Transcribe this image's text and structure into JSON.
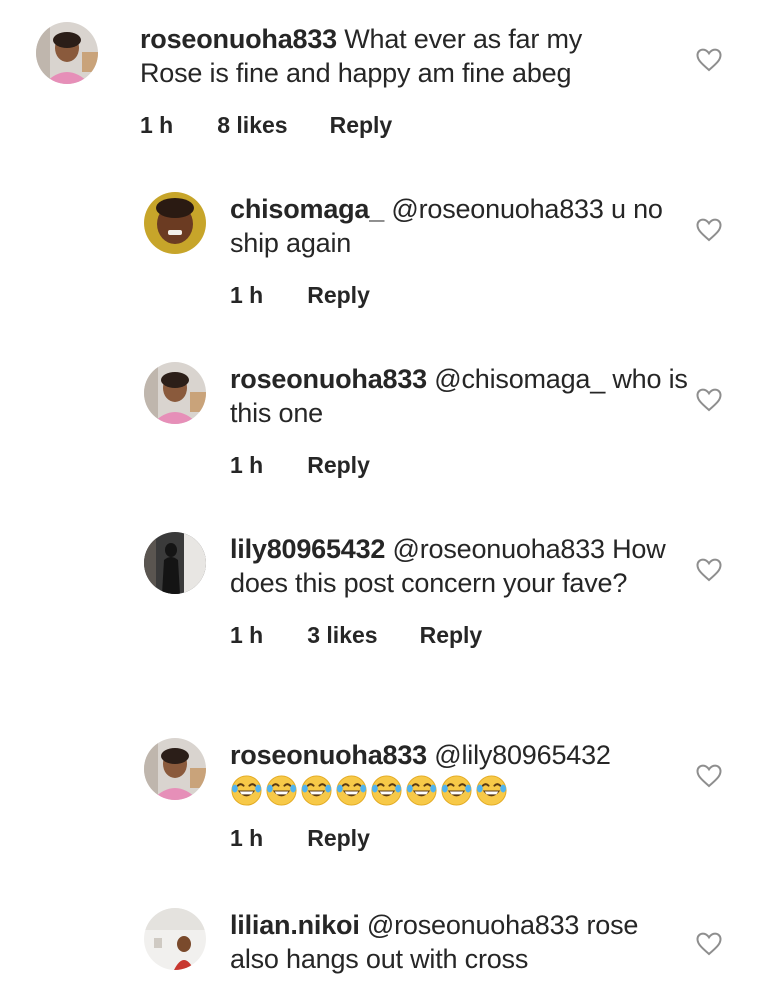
{
  "comments": [
    {
      "username": "roseonuoha833",
      "text": " What ever as far my Rose is fine and happy am fine abeg",
      "time": "1 h",
      "likes": "8 likes",
      "reply": "Reply",
      "avatar": "rose-avatar"
    },
    {
      "username": "chisomaga_",
      "text": " @roseonuoha833 u no ship again",
      "time": "1 h",
      "likes": "",
      "reply": "Reply",
      "avatar": "child-avatar"
    },
    {
      "username": "roseonuoha833",
      "text": " @chisomaga_ who is this one",
      "time": "1 h",
      "likes": "",
      "reply": "Reply",
      "avatar": "rose-avatar"
    },
    {
      "username": "lily80965432",
      "text": " @roseonuoha833 How does this post concern your fave?",
      "time": "1 h",
      "likes": "3 likes",
      "reply": "Reply",
      "avatar": "silhouette-avatar"
    },
    {
      "username": "roseonuoha833",
      "text": " @lily80965432",
      "emoji": "tears-of-joy-emoji",
      "emoji_count": 8,
      "time": "1 h",
      "likes": "",
      "reply": "Reply",
      "avatar": "rose-avatar"
    },
    {
      "username": "lilian.nikoi",
      "text": " @roseonuoha833 rose also hangs out with cross",
      "avatar": "light-avatar"
    }
  ],
  "icons": {
    "like": "heart-outline-icon"
  },
  "colors": {
    "text": "#262626",
    "heart_stroke": "#8e8e8e",
    "background": "#ffffff"
  }
}
